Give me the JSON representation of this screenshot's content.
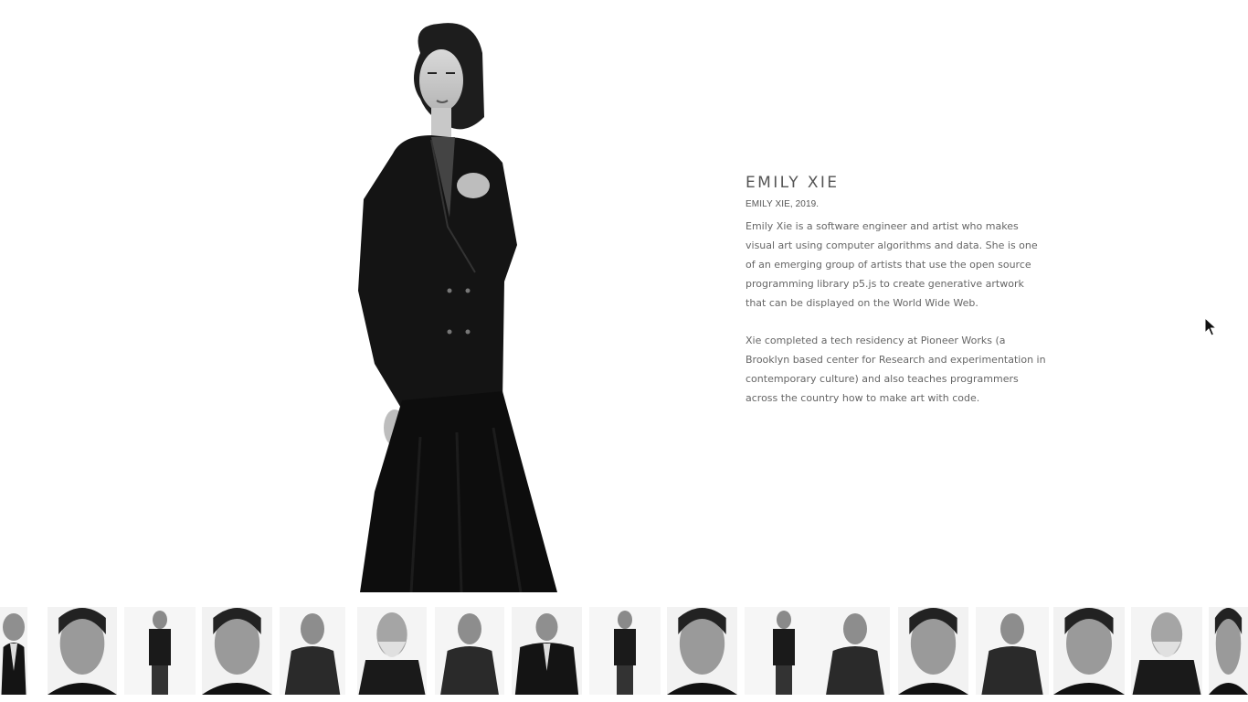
{
  "profile": {
    "name": "EMILY XIE",
    "caption": "EMILY XIE, 2019.",
    "paragraphs": [
      "Emily Xie is a software engineer and artist who makes visual art using computer algorithms and data. She is one of an emerging group of artists that use the open source programming library p5.js to create generative artwork that can be displayed on the World Wide Web.",
      "Xie completed a tech residency at Pioneer Works (a Brooklyn based center for Research and experimentation in contemporary culture) and also teaches programmers across the country how to make art with code."
    ]
  },
  "portrait_style": "black-and-white",
  "thumbnails": {
    "count": 18,
    "selected_index": 9
  }
}
